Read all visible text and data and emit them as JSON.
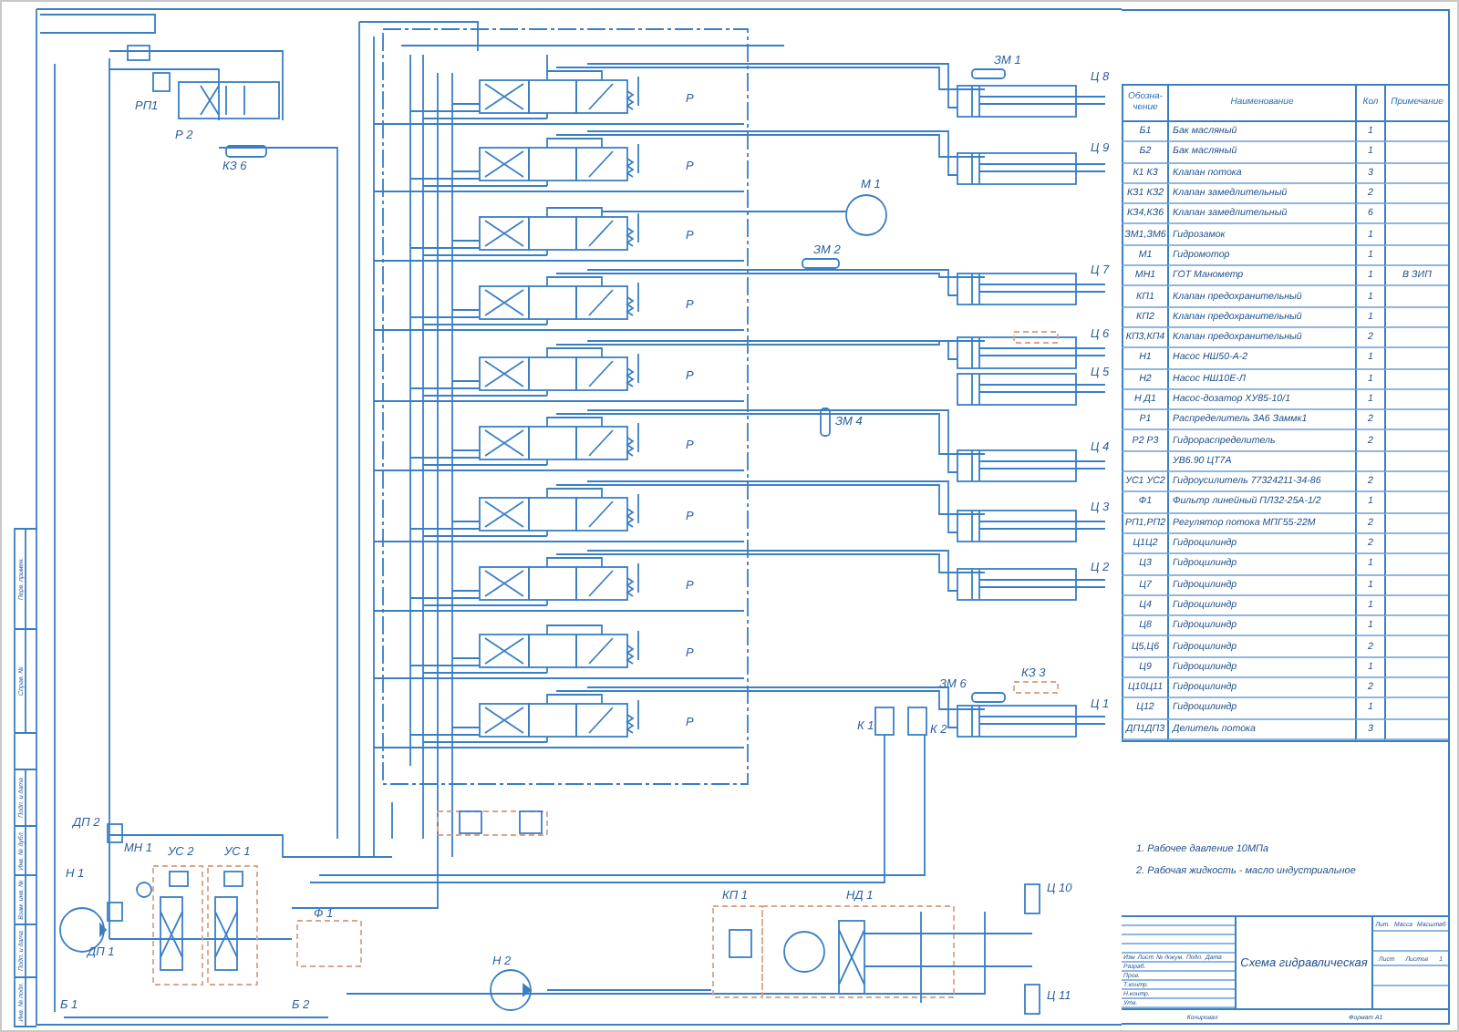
{
  "schematic": {
    "valve_labels": [
      "Р",
      "Р",
      "Р",
      "Р",
      "Р",
      "Р",
      "Р",
      "Р",
      "Р",
      "Р"
    ],
    "labels": [
      "РП1",
      "Р 2",
      "КЗ 6",
      "М 1",
      "ЗМ 1",
      "Ц 8",
      "Ц 9",
      "ЗМ 2",
      "Ц 7",
      "Ц 6",
      "Ц 5",
      "ЗМ 4",
      "Ц 4",
      "Ц 3",
      "Ц 2",
      "ЗМ 6",
      "КЗ 3",
      "К 1",
      "К 2",
      "Ц 1",
      "ДП 2",
      "МН 1",
      "УС 2",
      "УС 1",
      "Н 1",
      "ДП 1",
      "Ф 1",
      "Б 1",
      "Б 2",
      "Н 2",
      "КП 1",
      "НД 1",
      "Ц 10",
      "Ц 11"
    ]
  },
  "margin_stamps": [
    "Перв. примен.",
    "Справ. №",
    "Подп. и дата",
    "Инв. № дубл.",
    "Взам. инв. №",
    "Подп. и дата",
    "Инв. № подл."
  ],
  "spec_table": {
    "columns": [
      "Обозна-чение",
      "Наименование",
      "Кол",
      "Примечание"
    ],
    "rows": [
      {
        "designation": "Б1",
        "name": "Бак масляный",
        "qty": "1"
      },
      {
        "designation": "Б2",
        "name": "Бак масляный",
        "qty": "1"
      },
      {
        "designation": "К1 К3",
        "name": "Клапан потока",
        "qty": "3"
      },
      {
        "designation": "КЗ1 КЗ2",
        "name": "Клапан замедлительный",
        "qty": "2"
      },
      {
        "designation": "КЗ4,КЗ6",
        "name": "Клапан замедлительный",
        "qty": "6"
      },
      {
        "designation": "ЗМ1,ЗМ6",
        "name": "Гидрозамок",
        "qty": "1"
      },
      {
        "designation": "М1",
        "name": "Гидромотор",
        "qty": "1"
      },
      {
        "designation": "МН1",
        "name": "ГОТ Манометр",
        "qty": "1",
        "note": "В ЗИП"
      },
      {
        "designation": "КП1",
        "name": "Клапан предохранительный",
        "qty": "1"
      },
      {
        "designation": "КП2",
        "name": "Клапан предохранительный",
        "qty": "1"
      },
      {
        "designation": "КП3,КП4",
        "name": "Клапан предохранительный",
        "qty": "2"
      },
      {
        "designation": "Н1",
        "name": "Насос НШ50-А-2",
        "qty": "1"
      },
      {
        "designation": "Н2",
        "name": "Насос НШ10Е-Л",
        "qty": "1"
      },
      {
        "designation": "Н Д1",
        "name": "Насос-дозатор ХУ85-10/1",
        "qty": "1"
      },
      {
        "designation": "Р1",
        "name": "Распределитель 3А6 Заммк1",
        "qty": "2"
      },
      {
        "designation": "Р2 Р3",
        "name": "Гидрораспределитель",
        "qty": "2"
      },
      {
        "name": "УВ6.90 ЦТ7А"
      },
      {
        "designation": "УС1 УС2",
        "name": "Гидроусилитель 77324211-34-86",
        "qty": "2"
      },
      {
        "designation": "Ф1",
        "name": "Фильтр линейный ПЛ32-25А-1/2",
        "qty": "1"
      },
      {
        "designation": "РП1,РП2",
        "name": "Регулятор потока МПГ55-22М",
        "qty": "2"
      },
      {
        "designation": "Ц1Ц2",
        "name": "Гидроцилиндр",
        "qty": "2"
      },
      {
        "designation": "Ц3",
        "name": "Гидроцилиндр",
        "qty": "1"
      },
      {
        "designation": "Ц7",
        "name": "Гидроцилиндр",
        "qty": "1"
      },
      {
        "designation": "Ц4",
        "name": "Гидроцилиндр",
        "qty": "1"
      },
      {
        "designation": "Ц8",
        "name": "Гидроцилиндр",
        "qty": "1"
      },
      {
        "designation": "Ц5,Ц6",
        "name": "Гидроцилиндр",
        "qty": "2"
      },
      {
        "designation": "Ц9",
        "name": "Гидроцилиндр",
        "qty": "1"
      },
      {
        "designation": "Ц10Ц11",
        "name": "Гидроцилиндр",
        "qty": "2"
      },
      {
        "designation": "Ц12",
        "name": "Гидроцилиндр",
        "qty": "1"
      },
      {
        "designation": "ДП1ДП3",
        "name": "Делитель потока",
        "qty": "3"
      }
    ]
  },
  "notes": [
    "1. Рабочее давление    10МПа",
    "2. Рабочая жидкость  -  масло индустриальное"
  ],
  "title_block": {
    "title": "Схема гидравлическая",
    "change_header": [
      "Изм",
      "Лист",
      "№ докум.",
      "Подп.",
      "Дата"
    ],
    "signers": [
      "Разраб.",
      "Пров.",
      "Т.контр.",
      "Н.контр.",
      "Утв."
    ],
    "stamp_header": [
      "Лит.",
      "Масса",
      "Масштаб"
    ],
    "sheet_header": [
      "Лист",
      "Листов",
      "1"
    ]
  },
  "footer": {
    "copied": "Копировал",
    "format": "Формат  А1"
  }
}
